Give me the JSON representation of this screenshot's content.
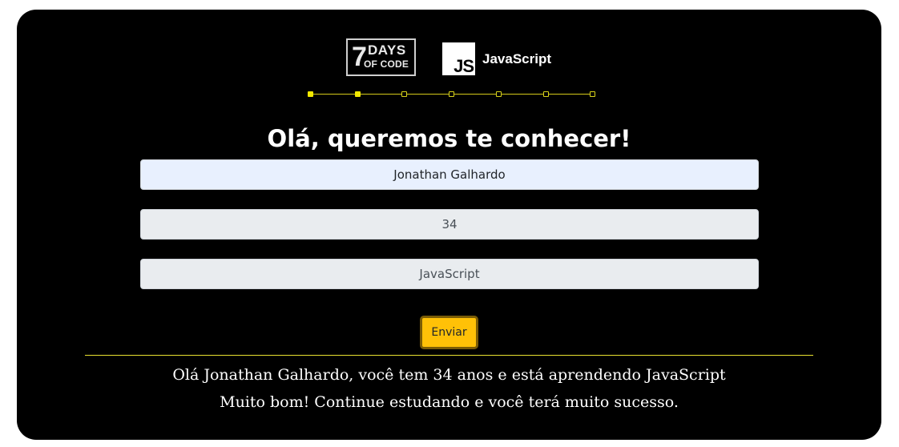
{
  "logos": {
    "sevendays": {
      "seven": "7",
      "days": "DAYS",
      "ofcode": "OF CODE"
    },
    "js": {
      "badge": "JS",
      "label": "JavaScript"
    }
  },
  "stepper": {
    "total": 7,
    "completed": 2
  },
  "title": "Olá, queremos te conhecer!",
  "form": {
    "name_value": "Jonathan Galhardo",
    "age_value": "34",
    "language_value": "JavaScript",
    "submit_label": "Enviar"
  },
  "result": {
    "line1": "Olá Jonathan Galhardo, você tem 34 anos e está aprendendo JavaScript",
    "line2": "Muito bom! Continue estudando e você terá muito sucesso."
  },
  "colors": {
    "background": "#000000",
    "accent": "#ffc107",
    "stepper": "#f2e800"
  }
}
